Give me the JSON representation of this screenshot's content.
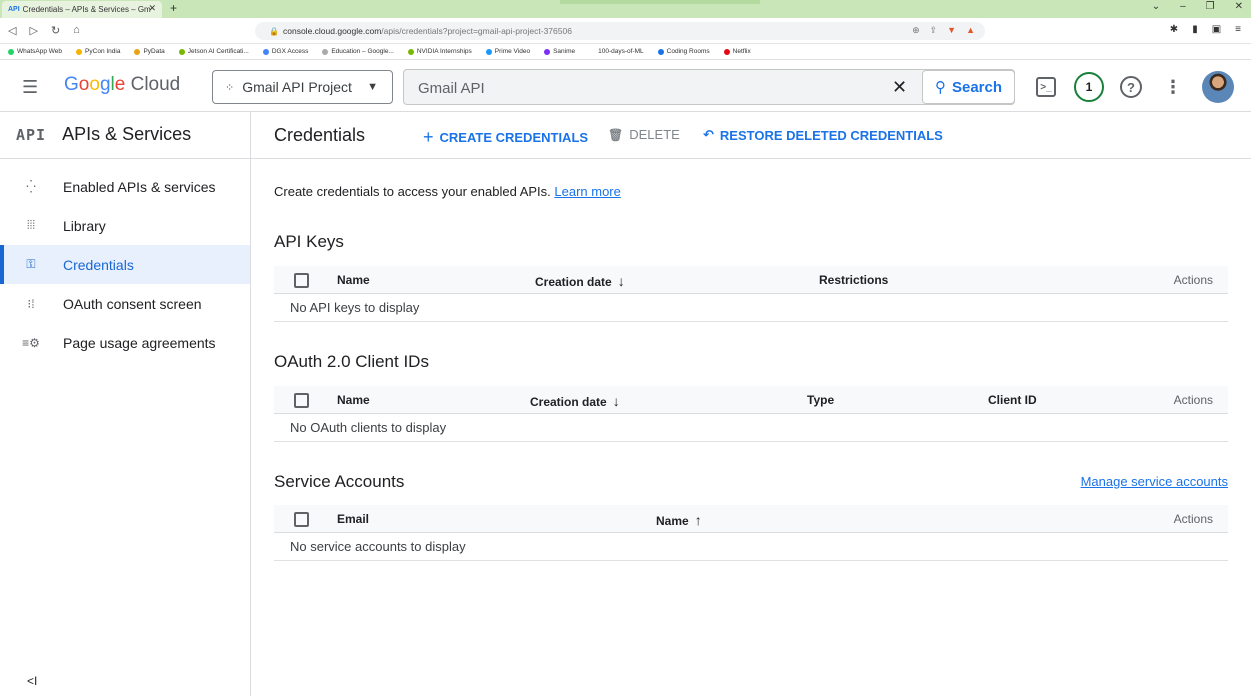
{
  "browser": {
    "tab_title": "Credentials – APIs & Services – Gm",
    "tab_icon": "API",
    "url_host": "console.cloud.google.com",
    "url_path": "/apis/credentials?project=gmail-api-project-376506",
    "bookmarks": [
      {
        "label": "WhatsApp Web",
        "color": "#25d366"
      },
      {
        "label": "PyCon India",
        "color": "#f4b400"
      },
      {
        "label": "PyData",
        "color": "#e8a317"
      },
      {
        "label": "Jetson AI Certificati...",
        "color": "#76b900"
      },
      {
        "label": "DGX Access",
        "color": "#4285f4"
      },
      {
        "label": "Education – Google...",
        "color": "#aaaaaa"
      },
      {
        "label": "NVIDIA Internships",
        "color": "#76b900"
      },
      {
        "label": "Prime Video",
        "color": "#1a98ff"
      },
      {
        "label": "Sanime",
        "color": "#7b2ff7"
      },
      {
        "label": "100-days-of-ML",
        "color": "#ffffff"
      },
      {
        "label": "Coding Rooms",
        "color": "#1a73e8"
      },
      {
        "label": "Netflix",
        "color": "#e50914"
      }
    ]
  },
  "header": {
    "logo_google": "Google",
    "logo_cloud": " Cloud",
    "project": "Gmail API Project",
    "search_value": "Gmail API",
    "search_button": "Search",
    "notification_count": "1"
  },
  "sidebar": {
    "api_logo": "API",
    "title": "APIs & Services",
    "items": [
      {
        "label": "Enabled APIs & services",
        "icon": "diamond-dots-icon"
      },
      {
        "label": "Library",
        "icon": "library-icon"
      },
      {
        "label": "Credentials",
        "icon": "key-icon"
      },
      {
        "label": "OAuth consent screen",
        "icon": "consent-icon"
      },
      {
        "label": "Page usage agreements",
        "icon": "settings-list-icon"
      }
    ],
    "collapse_label": "<I"
  },
  "main": {
    "title": "Credentials",
    "actions": {
      "create": "CREATE CREDENTIALS",
      "delete": "DELETE",
      "restore": "RESTORE DELETED CREDENTIALS"
    },
    "intro_text": "Create credentials to access your enabled APIs. ",
    "learn_more": "Learn more",
    "api_keys": {
      "title": "API Keys",
      "columns": [
        "Name",
        "Creation date",
        "Restrictions",
        "Actions"
      ],
      "empty": "No API keys to display"
    },
    "oauth": {
      "title": "OAuth 2.0 Client IDs",
      "columns": [
        "Name",
        "Creation date",
        "Type",
        "Client ID",
        "Actions"
      ],
      "empty": "No OAuth clients to display"
    },
    "service_accounts": {
      "title": "Service Accounts",
      "manage_link": "Manage service accounts",
      "columns": [
        "Email",
        "Name",
        "Actions"
      ],
      "empty": "No service accounts to display"
    }
  },
  "colors": {
    "accent": "#1a73e8",
    "active_bg": "#e8f0fe"
  }
}
